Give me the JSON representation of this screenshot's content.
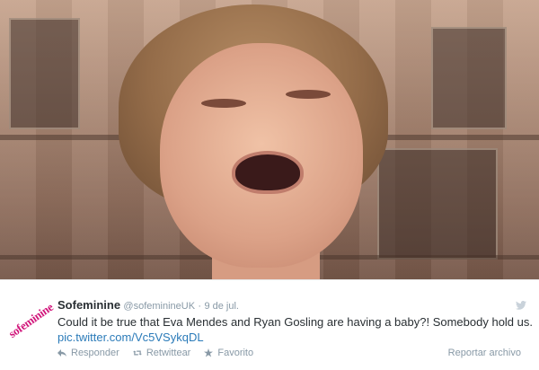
{
  "tweet": {
    "author_name": "Sofeminine",
    "handle": "@sofeminineUK",
    "separator": "·",
    "date": "9 de jul.",
    "text": "Could it be true that Eva Mendes and Ryan Gosling are having a baby?! Somebody hold us.",
    "link": "pic.twitter.com/Vc5VSykqDL"
  },
  "avatar": {
    "logo_text": "sofeminine",
    "color": "#d1147a"
  },
  "actions": {
    "reply_label": "Responder",
    "retweet_label": "Retwittear",
    "favorite_label": "Favorito",
    "report_label": "Reportar archivo"
  },
  "icons": {
    "reply": "reply-icon",
    "retweet": "retweet-icon",
    "favorite": "star-icon",
    "bird": "twitter-bird-icon"
  }
}
